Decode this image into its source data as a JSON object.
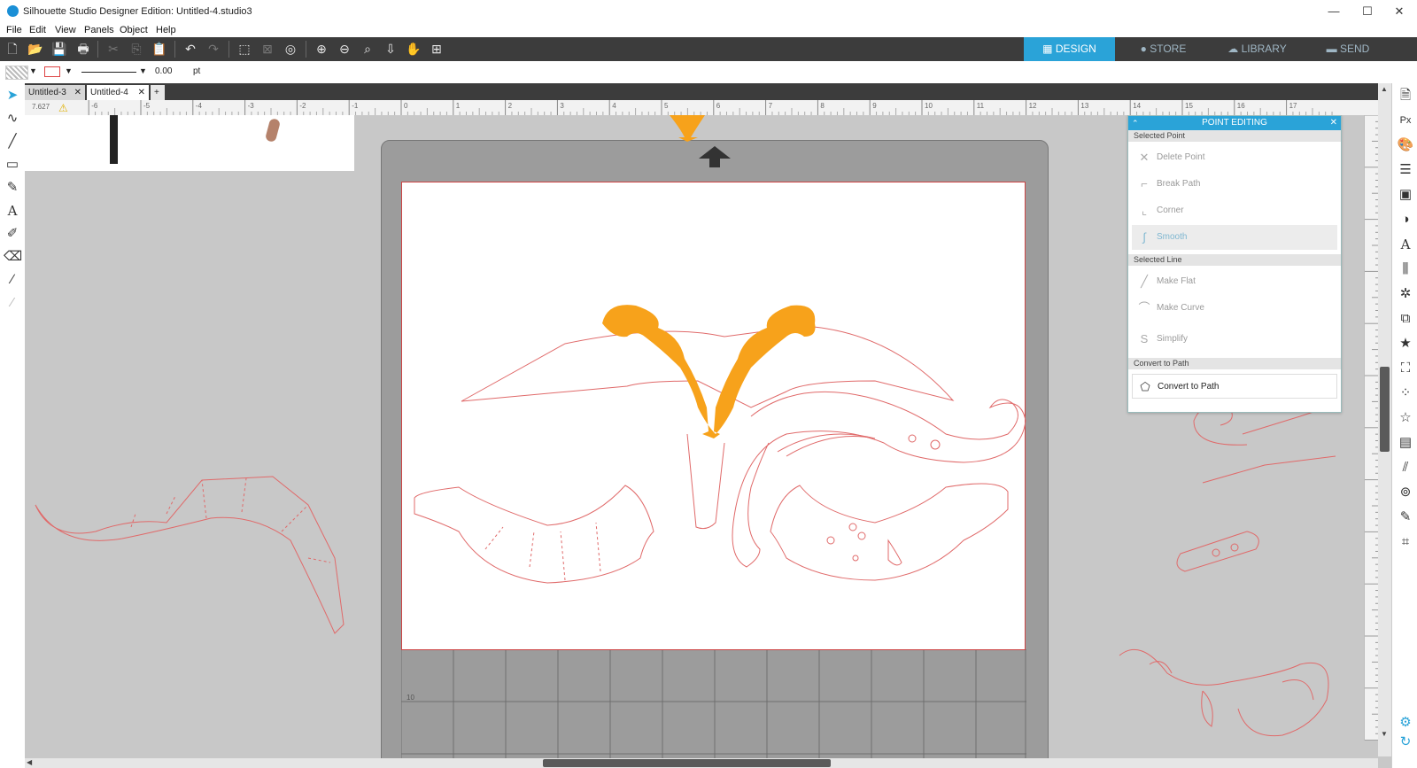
{
  "window": {
    "title": "Silhouette Studio Designer Edition: Untitled-4.studio3",
    "minimize": "—",
    "maximize": "☐",
    "close": "✕"
  },
  "menu": [
    "File",
    "Edit",
    "View",
    "Panels",
    "Object",
    "Help"
  ],
  "toolbar": {
    "tabs": [
      {
        "label": "DESIGN",
        "icon": "grid-icon",
        "active": true
      },
      {
        "label": "STORE",
        "icon": "store-icon",
        "active": false
      },
      {
        "label": "LIBRARY",
        "icon": "cloud-icon",
        "active": false
      },
      {
        "label": "SEND",
        "icon": "cutter-icon",
        "active": false
      }
    ]
  },
  "properties": {
    "line_width_value": "0.00",
    "line_width_unit": "pt"
  },
  "documents": [
    {
      "label": "Untitled-3",
      "active": false
    },
    {
      "label": "Untitled-4",
      "active": true
    }
  ],
  "new_tab_label": "+",
  "ruler": {
    "corner_readout": "7.627",
    "h_labels": [
      "-6",
      "-5",
      "-4",
      "-3",
      "-2",
      "-1",
      "0",
      "1",
      "2",
      "3",
      "4",
      "5",
      "6",
      "7",
      "8",
      "9",
      "10",
      "11",
      "12",
      "13",
      "14",
      "15",
      "16",
      "17"
    ],
    "mat_row_label": "10"
  },
  "point_editing": {
    "title": "POINT EDITING",
    "sections": [
      {
        "heading": "Selected Point",
        "buttons": [
          {
            "label": "Delete Point",
            "icon": "delete-point-icon",
            "glyph": "✕",
            "enabled": false
          },
          {
            "label": "Break Path",
            "icon": "break-path-icon",
            "glyph": "⌐",
            "enabled": false
          },
          {
            "label": "Corner",
            "icon": "corner-icon",
            "glyph": "⌞",
            "enabled": false
          },
          {
            "label": "Smooth",
            "icon": "smooth-icon",
            "glyph": "∫",
            "enabled": false,
            "highlighted": true
          }
        ]
      },
      {
        "heading": "Selected Line",
        "buttons": [
          {
            "label": "Make Flat",
            "icon": "make-flat-icon",
            "glyph": "╱",
            "enabled": false
          },
          {
            "label": "Make Curve",
            "icon": "make-curve-icon",
            "glyph": "⌒",
            "enabled": false
          },
          {
            "label": "Simplify",
            "icon": "simplify-icon",
            "glyph": "S",
            "enabled": false
          }
        ]
      },
      {
        "heading": "Convert to Path",
        "buttons": [
          {
            "label": "Convert to Path",
            "icon": "convert-to-path-icon",
            "glyph": "⬠",
            "enabled": true
          }
        ]
      }
    ]
  },
  "colors": {
    "accent": "#2aa3d8",
    "toolbar_bg": "#3c3c3c",
    "cut_line": "#e06a6a",
    "selected_shape": "#f7a21b",
    "mat": "#9c9c9c"
  }
}
